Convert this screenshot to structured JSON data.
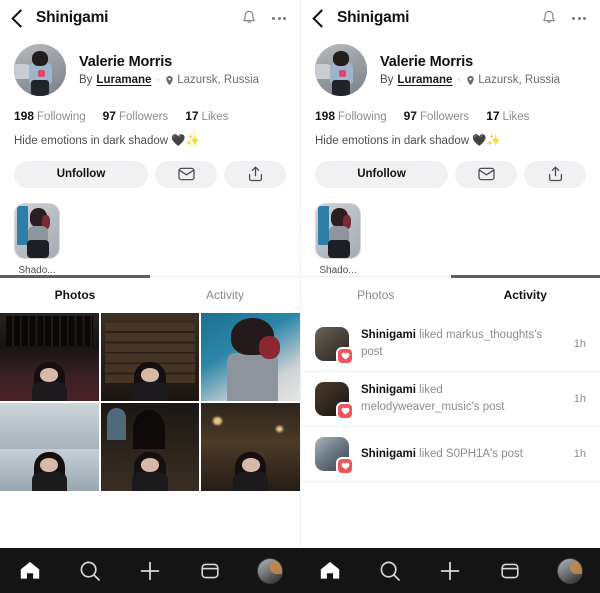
{
  "panels": [
    {
      "id": "left",
      "header": {
        "back_icon": "chevron-left-icon",
        "title": "Shinigami",
        "bell_icon": "bell-icon",
        "more_icon": "ellipsis-icon"
      },
      "profile": {
        "avatar": "profile-avatar",
        "display_name": "Valerie Morris",
        "by_word": "By",
        "author": "Luramane",
        "separator": "·",
        "location_icon": "location-pin-icon",
        "location": "Lazursk, Russia",
        "stats": [
          {
            "value": "198",
            "label": "Following"
          },
          {
            "value": "97",
            "label": "Followers"
          },
          {
            "value": "17",
            "label": "Likes"
          }
        ],
        "bio": "Hide emotions in dark shadow 🖤✨"
      },
      "actions": {
        "follow_label": "Unfollow",
        "message_icon": "envelope-icon",
        "share_icon": "share-up-icon"
      },
      "highlights": [
        {
          "label": "Shado...",
          "thumb": "story-highlight-thumb"
        }
      ],
      "tabs": {
        "items": [
          {
            "label": "Photos",
            "active": true
          },
          {
            "label": "Activity",
            "active": false
          }
        ],
        "active_index": 0
      },
      "photos": [
        {
          "name": "photo-cathedral-seats"
        },
        {
          "name": "photo-library-shelf"
        },
        {
          "name": "photo-studio-blue"
        },
        {
          "name": "photo-lake-shore"
        },
        {
          "name": "photo-gothic-church"
        },
        {
          "name": "photo-night-alley"
        }
      ]
    },
    {
      "id": "right",
      "header": {
        "back_icon": "chevron-left-icon",
        "title": "Shinigami",
        "bell_icon": "bell-icon",
        "more_icon": "ellipsis-icon"
      },
      "profile": {
        "avatar": "profile-avatar",
        "display_name": "Valerie Morris",
        "by_word": "By",
        "author": "Luramane",
        "separator": "·",
        "location_icon": "location-pin-icon",
        "location": "Lazursk, Russia",
        "stats": [
          {
            "value": "198",
            "label": "Following"
          },
          {
            "value": "97",
            "label": "Followers"
          },
          {
            "value": "17",
            "label": "Likes"
          }
        ],
        "bio": "Hide emotions in dark shadow 🖤✨"
      },
      "actions": {
        "follow_label": "Unfollow",
        "message_icon": "envelope-icon",
        "share_icon": "share-up-icon"
      },
      "highlights": [
        {
          "label": "Shado...",
          "thumb": "story-highlight-thumb"
        }
      ],
      "tabs": {
        "items": [
          {
            "label": "Photos",
            "active": false
          },
          {
            "label": "Activity",
            "active": true
          }
        ],
        "active_index": 1
      },
      "activity": [
        {
          "actor": "Shinigami",
          "text": " liked markus_thoughts's post",
          "time": "1h",
          "badge_icon": "heart-icon"
        },
        {
          "actor": "Shinigami",
          "text": " liked melodyweaver_music's post",
          "time": "1h",
          "badge_icon": "heart-icon"
        },
        {
          "actor": "Shinigami",
          "text": " liked S0PH1A's post",
          "time": "1h",
          "badge_icon": "heart-icon"
        }
      ]
    }
  ],
  "bottom_nav": {
    "items": [
      {
        "name": "home-icon",
        "active": true
      },
      {
        "name": "search-icon",
        "active": false
      },
      {
        "name": "plus-icon",
        "active": false
      },
      {
        "name": "inbox-icon",
        "active": false
      },
      {
        "name": "profile-avatar-icon",
        "active": false
      }
    ]
  },
  "colors": {
    "accent_heart": "#f2545b",
    "tab_indicator": "#5f5f63",
    "nav_background": "#141414",
    "button_background": "#f1f1f3"
  }
}
